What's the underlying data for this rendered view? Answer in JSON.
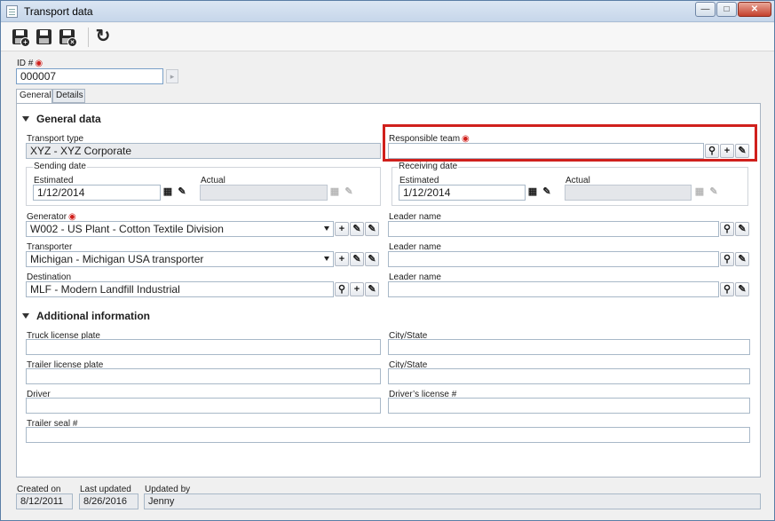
{
  "window": {
    "title": "Transport data"
  },
  "form": {
    "id_label": "ID #",
    "id_value": "000007",
    "tabs": [
      {
        "label": "General"
      },
      {
        "label": "Details"
      }
    ],
    "general": {
      "section_title": "General data",
      "transport_type_label": "Transport type",
      "transport_type_value": "XYZ - XYZ Corporate",
      "responsible_team_label": "Responsible team",
      "responsible_team_value": "",
      "sending_date_label": "Sending date",
      "receiving_date_label": "Receiving date",
      "estimated_label": "Estimated",
      "actual_label": "Actual",
      "sending_estimated": "1/12/2014",
      "receiving_estimated": "1/12/2014",
      "generator_label": "Generator",
      "generator_value": "W002 - US Plant - Cotton Textile Division",
      "transporter_label": "Transporter",
      "transporter_value": "Michigan - Michigan USA transporter",
      "destination_label": "Destination",
      "destination_value": "MLF - Modern Landfill Industrial",
      "leader_name_label": "Leader name"
    },
    "additional": {
      "section_title": "Additional information",
      "truck_plate_label": "Truck license plate",
      "trailer_plate_label": "Trailer license plate",
      "driver_label": "Driver",
      "trailer_seal_label": "Trailer seal #",
      "city_state_label": "City/State",
      "drivers_license_label": "Driver’s license #"
    }
  },
  "footer": {
    "created_on_label": "Created on",
    "created_on": "8/12/2011",
    "last_updated_label": "Last updated",
    "last_updated": "8/26/2016",
    "updated_by_label": "Updated by",
    "updated_by": "Jenny"
  },
  "colors": {
    "highlight": "#d0201c",
    "required": "#d0201c"
  }
}
